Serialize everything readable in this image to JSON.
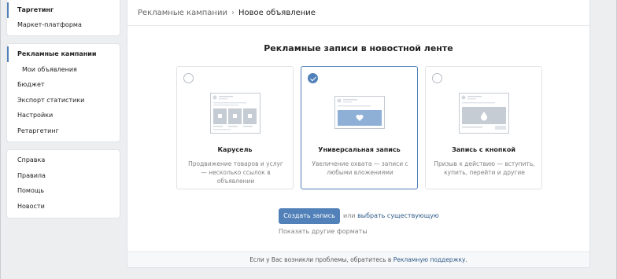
{
  "sidebar": {
    "top": [
      {
        "label": "Таргетинг"
      },
      {
        "label": "Маркет-платформа"
      }
    ],
    "ads": [
      {
        "label": "Рекламные кампании"
      },
      {
        "label": "Мои объявления"
      },
      {
        "label": "Бюджет"
      },
      {
        "label": "Экспорт статистики"
      },
      {
        "label": "Настройки"
      },
      {
        "label": "Ретаргетинг"
      }
    ],
    "help": [
      {
        "label": "Справка"
      },
      {
        "label": "Правила"
      },
      {
        "label": "Помощь"
      },
      {
        "label": "Новости"
      }
    ]
  },
  "breadcrumb": {
    "parent": "Рекламные кампании",
    "separator": "›",
    "current": "Новое объявление"
  },
  "main": {
    "heading": "Рекламные записи в новостной ленте",
    "formats": [
      {
        "title": "Карусель",
        "description": "Продвижение товаров и услуг — несколько ссылок в объявлении",
        "selected": false
      },
      {
        "title": "Универсальная запись",
        "description": "Увеличение охвата — записи с любыми вложениями",
        "selected": true
      },
      {
        "title": "Запись с кнопкой",
        "description": "Призыв к действию — вступить, купить, перейти и другие",
        "selected": false
      }
    ],
    "create_button": "Создать запись",
    "or_text": "или",
    "choose_existing": "выбрать существующую",
    "other_formats": "Показать другие форматы"
  },
  "footer": {
    "text": "Если у Вас возникли проблемы, обратитесь в",
    "link": "Рекламную поддержку",
    "end": "."
  },
  "colors": {
    "accent": "#5181b8",
    "link": "#2a5885",
    "background": "#edeef0"
  }
}
